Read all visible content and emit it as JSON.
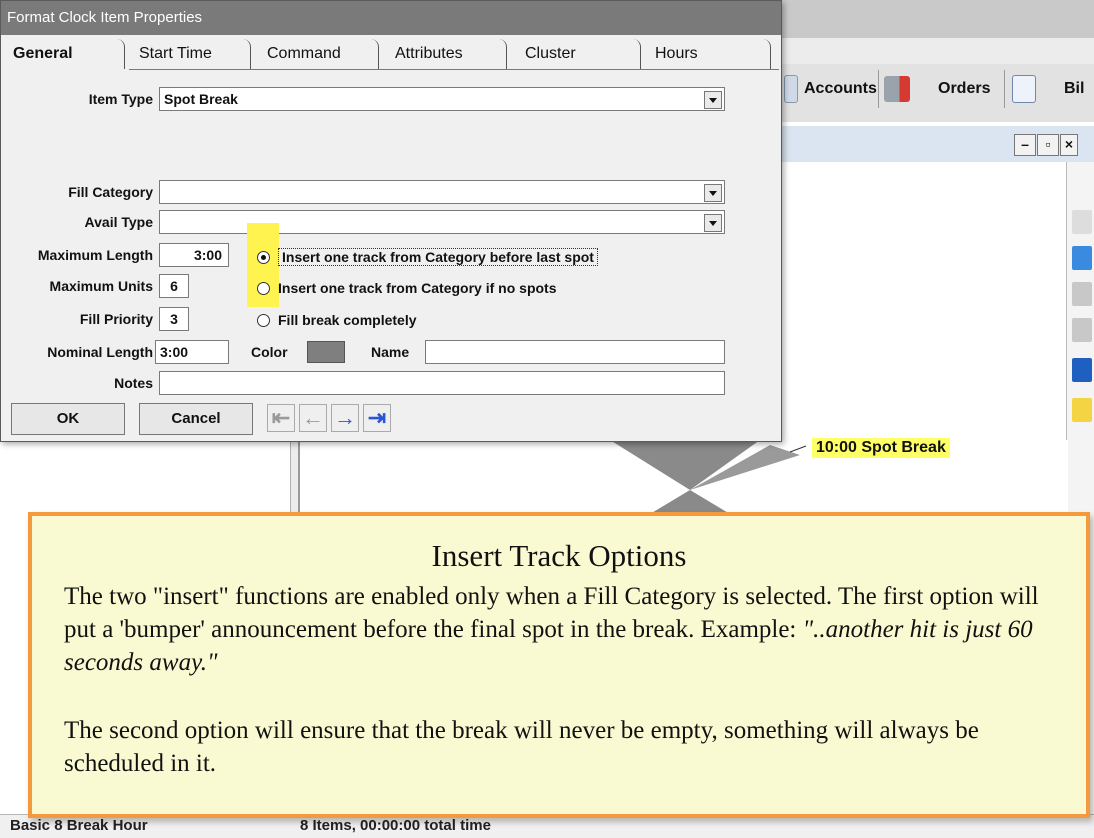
{
  "dialog": {
    "title": "Format Clock Item Properties",
    "tabs": [
      "General",
      "Start Time",
      "Command",
      "Attributes",
      "Cluster",
      "Hours"
    ],
    "active_tab": "General",
    "fields": {
      "item_type_label": "Item Type",
      "item_type_value": "Spot Break",
      "fill_category_label": "Fill Category",
      "fill_category_value": "",
      "avail_type_label": "Avail Type",
      "avail_type_value": "",
      "max_length_label": "Maximum Length",
      "max_length_value": "3:00",
      "max_units_label": "Maximum Units",
      "max_units_value": "6",
      "fill_priority_label": "Fill Priority",
      "fill_priority_value": "3",
      "nominal_length_label": "Nominal Length",
      "nominal_length_value": "3:00",
      "color_label": "Color",
      "color_value": "#7f7f7f",
      "name_label": "Name",
      "name_value": "",
      "notes_label": "Notes",
      "notes_value": ""
    },
    "radio_options": [
      {
        "label": "Insert one track from Category before last spot",
        "selected": true
      },
      {
        "label": "Insert one track from Category if no spots",
        "selected": false
      },
      {
        "label": "Fill break completely",
        "selected": false
      }
    ],
    "buttons": {
      "ok": "OK",
      "cancel": "Cancel"
    },
    "nav_icons": [
      "first-icon",
      "prev-icon",
      "next-icon",
      "last-icon"
    ]
  },
  "background": {
    "toolbar": {
      "accounts": "Accounts",
      "orders": "Orders",
      "billing": "Bil"
    },
    "spot_label": "10:00 Spot Break",
    "status_left": "Basic 8 Break Hour",
    "status_right": "8 Items, 00:00:00 total time"
  },
  "callout": {
    "title": "Insert Track Options",
    "p1": "The two \"insert\" functions are enabled only when a Fill Category is selected. The first option will put a 'bumper' announcement before the final spot in the break. Example: ",
    "p1_example": "\"..another hit is just 60 seconds away.\"",
    "p2": "The second option will ensure that the break will never be empty, something will always be scheduled in it."
  },
  "colors": {
    "highlight": "#fff44f",
    "callout_border": "#f59a3c",
    "callout_bg": "#fafad2",
    "nav_arrow": "#2a55d4"
  }
}
